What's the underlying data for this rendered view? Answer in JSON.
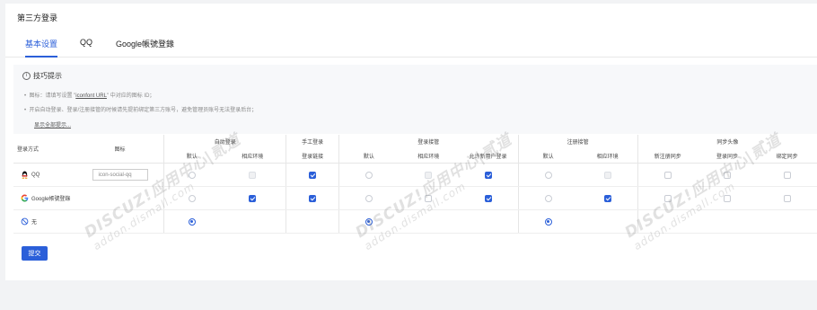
{
  "page": {
    "title": "第三方登录"
  },
  "tabs": [
    {
      "label": "基本设置"
    },
    {
      "label": "QQ"
    },
    {
      "label": "Google帳號登錄"
    }
  ],
  "tips": {
    "title": "技巧提示",
    "line1_prefix": "图标：请填写设置 \"",
    "line1_link": "iconfont URL",
    "line1_suffix": "\" 中对应的图标 ID；",
    "line2": "开启自动登录、登录/注册接管的时候请先提前绑定第三方账号，避免管理员账号无法登录后台；",
    "show_all": "显示全部提示..."
  },
  "table": {
    "col_login_method": "登录方式",
    "col_icon": "图标",
    "groups": {
      "auto_login": "自动登录",
      "manual_login": "手工登录",
      "login_takeover": "登录接管",
      "register_takeover": "注册接管",
      "sync_avatar": "同步头像"
    },
    "sub": {
      "default": "默认",
      "env": "相应环境",
      "login_link": "登录链接",
      "allow_new_user": "允许新用户登录",
      "new_register_sync": "新注册同步",
      "login_sync": "登录同步",
      "bind_sync": "绑定同步"
    },
    "rows": [
      {
        "name": "QQ",
        "icon_value": "icon-social-qq",
        "icon": "qq-penguin-icon"
      },
      {
        "name": "Google帳號登錄",
        "icon_value": "",
        "icon": "google-g-icon"
      },
      {
        "name": "无",
        "icon_value": "",
        "icon": "none-circle-icon"
      }
    ]
  },
  "submit_label": "提交",
  "watermark": {
    "main": "DISCUZ!应用中心|贰道",
    "sub": "addon.dismall.com"
  },
  "colors": {
    "accent": "#2b5fd9"
  }
}
